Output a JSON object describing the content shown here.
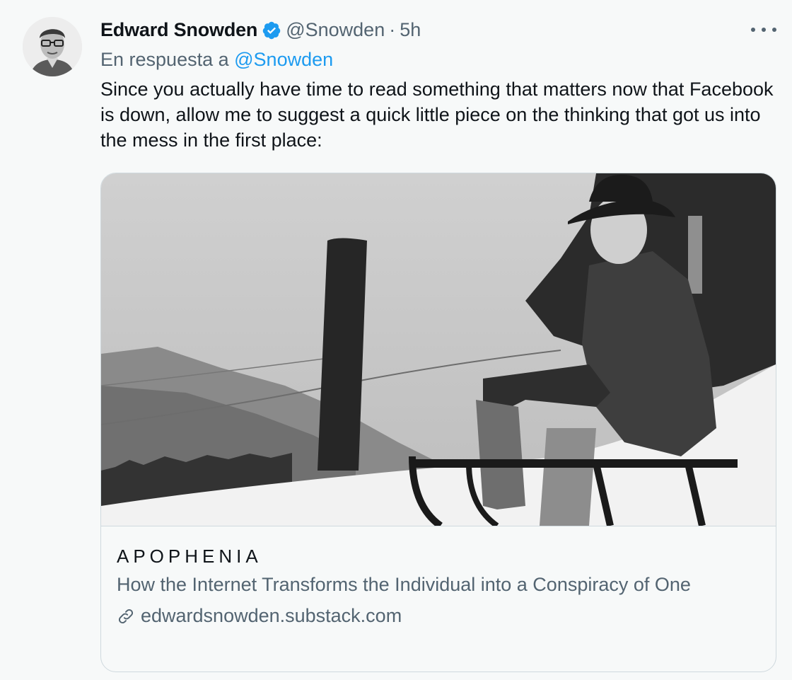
{
  "tweet": {
    "author_name": "Edward Snowden",
    "handle": "@Snowden",
    "separator": "·",
    "time": "5h",
    "reply_prefix": "En respuesta a",
    "reply_to": "@Snowden",
    "text": "Since you actually have time to read something that matters now that Facebook is down, allow me to suggest a quick little piece on the thinking that got us into the mess in the first place:",
    "verified_color": "#1d9bf0",
    "link_color": "#1d9bf0"
  },
  "card": {
    "site": "APOPHENIA",
    "title": "How the Internet Transforms the Individual into a Conspiracy of One",
    "domain": "edwardsnowden.substack.com"
  },
  "icons": {
    "verified": "verified-badge-icon",
    "more": "more-horizontal-icon",
    "link": "link-icon"
  }
}
